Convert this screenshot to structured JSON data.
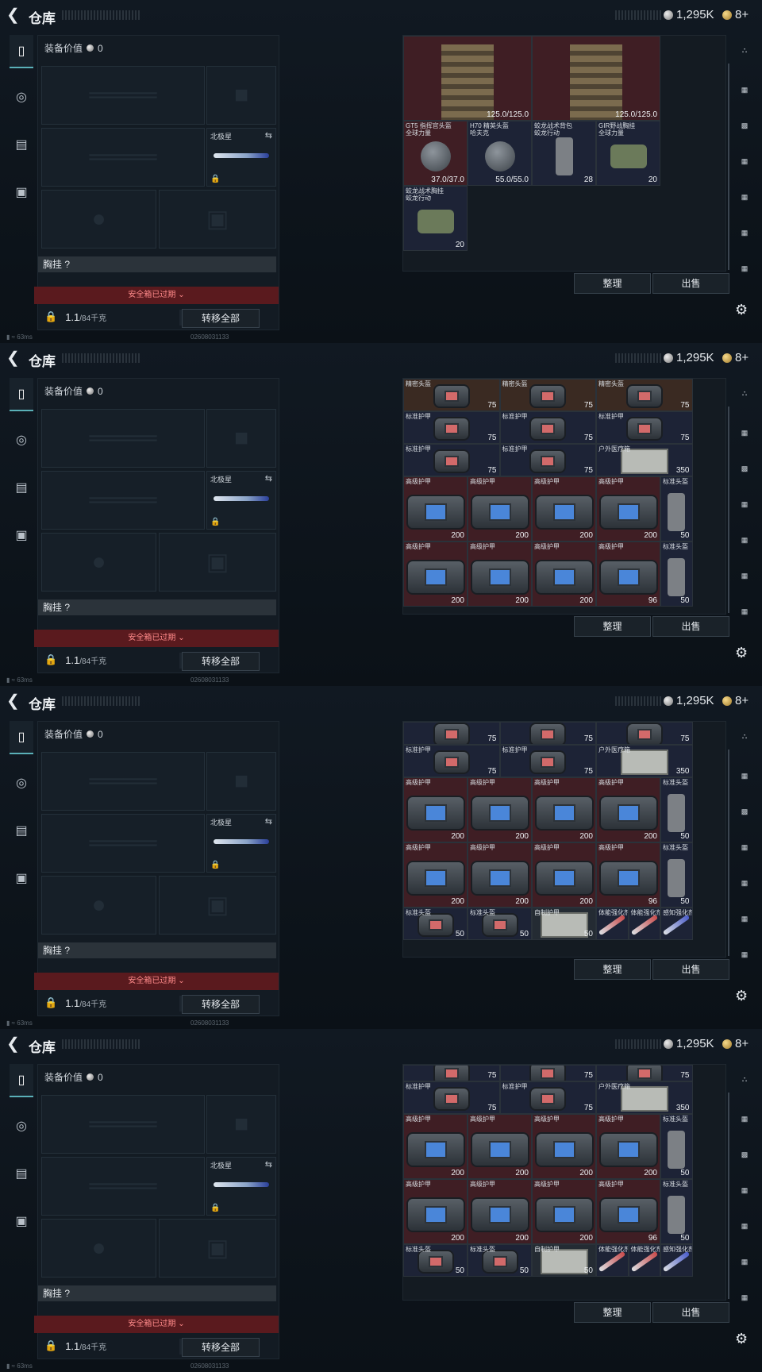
{
  "header": {
    "title": "仓库",
    "silver": "1,295K",
    "gold": "8+"
  },
  "left": {
    "equip_value_label": "装备价值",
    "equip_value": "0",
    "knife_name": "北极星",
    "chest_label": "胸挂",
    "chest_help": "?",
    "safebox": "安全箱已过期",
    "weight": "1.1",
    "weight_cap": "/84千克",
    "transfer_all": "转移全部"
  },
  "footer": {
    "sort": "整理",
    "sell": "出售",
    "ping": "63ms",
    "id": "02608031133"
  },
  "frames": [
    {
      "items": [
        {
          "name": "",
          "value": "125.0/125.0",
          "kind": "armorpiece",
          "bg": "red",
          "c": 0,
          "r": 0,
          "w": 2,
          "h": 1.3
        },
        {
          "name": "",
          "value": "125.0/125.0",
          "kind": "armorpiece",
          "bg": "red",
          "c": 2,
          "r": 0,
          "w": 2,
          "h": 1.3
        },
        {
          "name": "GT5 指挥官头盔\n全球力量",
          "value": "37.0/37.0",
          "kind": "helm",
          "bg": "red",
          "c": 0,
          "r": 1.3,
          "w": 1,
          "h": 1
        },
        {
          "name": "H70 精英头盔\n哈夫克",
          "value": "55.0/55.0",
          "kind": "helm",
          "bg": "blue",
          "c": 1,
          "r": 1.3,
          "w": 1,
          "h": 1
        },
        {
          "name": "蛟龙战术背包\n蛟龙行动",
          "value": "28",
          "kind": "pack",
          "bg": "blue",
          "c": 2,
          "r": 1.3,
          "w": 1,
          "h": 1
        },
        {
          "name": "GIR野战胸挂\n全球力量",
          "value": "20",
          "kind": "rig",
          "bg": "blue",
          "c": 3,
          "r": 1.3,
          "w": 1,
          "h": 1
        },
        {
          "name": "蛟龙战术胸挂\n蛟龙行动",
          "value": "20",
          "kind": "rig",
          "bg": "blue",
          "c": 0,
          "r": 2.3,
          "w": 1,
          "h": 1
        }
      ]
    },
    {
      "items": [
        {
          "name": "精密头盔",
          "value": "75",
          "kind": "vest-s",
          "bg": "brown",
          "c": 0,
          "r": 0,
          "w": 1.5,
          "h": 0.5
        },
        {
          "name": "精密头盔",
          "value": "75",
          "kind": "vest-s",
          "bg": "brown",
          "c": 1.5,
          "r": 0,
          "w": 1.5,
          "h": 0.5
        },
        {
          "name": "精密头盔",
          "value": "75",
          "kind": "vest-s",
          "bg": "brown",
          "c": 3,
          "r": 0,
          "w": 1.5,
          "h": 0.5
        },
        {
          "name": "标准护甲",
          "value": "75",
          "kind": "vest-s",
          "bg": "blue",
          "c": 0,
          "r": 0.5,
          "w": 1.5,
          "h": 0.5
        },
        {
          "name": "标准护甲",
          "value": "75",
          "kind": "vest-s",
          "bg": "blue",
          "c": 1.5,
          "r": 0.5,
          "w": 1.5,
          "h": 0.5
        },
        {
          "name": "标准护甲",
          "value": "75",
          "kind": "vest-s",
          "bg": "blue",
          "c": 3,
          "r": 0.5,
          "w": 1.5,
          "h": 0.5
        },
        {
          "name": "标准护甲",
          "value": "75",
          "kind": "vest-s",
          "bg": "blue",
          "c": 0,
          "r": 1,
          "w": 1.5,
          "h": 0.5
        },
        {
          "name": "标准护甲",
          "value": "75",
          "kind": "vest-s",
          "bg": "blue",
          "c": 1.5,
          "r": 1,
          "w": 1.5,
          "h": 0.5
        },
        {
          "name": "户外医疗箱",
          "value": "350",
          "kind": "med",
          "bg": "blue",
          "c": 3,
          "r": 1,
          "w": 1.5,
          "h": 0.5
        },
        {
          "name": "高级护甲",
          "value": "200",
          "kind": "vest",
          "bg": "red",
          "c": 0,
          "r": 1.5,
          "w": 1,
          "h": 1
        },
        {
          "name": "高级护甲",
          "value": "200",
          "kind": "vest",
          "bg": "red",
          "c": 1,
          "r": 1.5,
          "w": 1,
          "h": 1
        },
        {
          "name": "高级护甲",
          "value": "200",
          "kind": "vest",
          "bg": "red",
          "c": 2,
          "r": 1.5,
          "w": 1,
          "h": 1
        },
        {
          "name": "高级护甲",
          "value": "200",
          "kind": "vest",
          "bg": "red",
          "c": 3,
          "r": 1.5,
          "w": 1,
          "h": 1
        },
        {
          "name": "标准头盔",
          "value": "50",
          "kind": "pack",
          "bg": "blue",
          "c": 4,
          "r": 1.5,
          "w": 0.5,
          "h": 1
        },
        {
          "name": "高级护甲",
          "value": "200",
          "kind": "vest",
          "bg": "red",
          "c": 0,
          "r": 2.5,
          "w": 1,
          "h": 1
        },
        {
          "name": "高级护甲",
          "value": "200",
          "kind": "vest",
          "bg": "red",
          "c": 1,
          "r": 2.5,
          "w": 1,
          "h": 1
        },
        {
          "name": "高级护甲",
          "value": "200",
          "kind": "vest",
          "bg": "red",
          "c": 2,
          "r": 2.5,
          "w": 1,
          "h": 1
        },
        {
          "name": "高级护甲",
          "value": "96",
          "kind": "vest",
          "bg": "red",
          "c": 3,
          "r": 2.5,
          "w": 1,
          "h": 1
        },
        {
          "name": "标准头盔",
          "value": "50",
          "kind": "pack",
          "bg": "blue",
          "c": 4,
          "r": 2.5,
          "w": 0.5,
          "h": 1
        }
      ]
    },
    {
      "items": [
        {
          "name": "",
          "value": "75",
          "kind": "vest-s",
          "bg": "blue",
          "c": 0,
          "r": 0,
          "w": 1.5,
          "h": 0.35
        },
        {
          "name": "",
          "value": "75",
          "kind": "vest-s",
          "bg": "blue",
          "c": 1.5,
          "r": 0,
          "w": 1.5,
          "h": 0.35
        },
        {
          "name": "",
          "value": "75",
          "kind": "vest-s",
          "bg": "blue",
          "c": 3,
          "r": 0,
          "w": 1.5,
          "h": 0.35
        },
        {
          "name": "标准护甲",
          "value": "75",
          "kind": "vest-s",
          "bg": "blue",
          "c": 0,
          "r": 0.35,
          "w": 1.5,
          "h": 0.5
        },
        {
          "name": "标准护甲",
          "value": "75",
          "kind": "vest-s",
          "bg": "blue",
          "c": 1.5,
          "r": 0.35,
          "w": 1.5,
          "h": 0.5
        },
        {
          "name": "户外医疗箱",
          "value": "350",
          "kind": "med",
          "bg": "blue",
          "c": 3,
          "r": 0.35,
          "w": 1.5,
          "h": 0.5
        },
        {
          "name": "高级护甲",
          "value": "200",
          "kind": "vest",
          "bg": "red",
          "c": 0,
          "r": 0.85,
          "w": 1,
          "h": 1
        },
        {
          "name": "高级护甲",
          "value": "200",
          "kind": "vest",
          "bg": "red",
          "c": 1,
          "r": 0.85,
          "w": 1,
          "h": 1
        },
        {
          "name": "高级护甲",
          "value": "200",
          "kind": "vest",
          "bg": "red",
          "c": 2,
          "r": 0.85,
          "w": 1,
          "h": 1
        },
        {
          "name": "高级护甲",
          "value": "200",
          "kind": "vest",
          "bg": "red",
          "c": 3,
          "r": 0.85,
          "w": 1,
          "h": 1
        },
        {
          "name": "标准头盔",
          "value": "50",
          "kind": "pack",
          "bg": "blue",
          "c": 4,
          "r": 0.85,
          "w": 0.5,
          "h": 1
        },
        {
          "name": "高级护甲",
          "value": "200",
          "kind": "vest",
          "bg": "red",
          "c": 0,
          "r": 1.85,
          "w": 1,
          "h": 1
        },
        {
          "name": "高级护甲",
          "value": "200",
          "kind": "vest",
          "bg": "red",
          "c": 1,
          "r": 1.85,
          "w": 1,
          "h": 1
        },
        {
          "name": "高级护甲",
          "value": "200",
          "kind": "vest",
          "bg": "red",
          "c": 2,
          "r": 1.85,
          "w": 1,
          "h": 1
        },
        {
          "name": "高级护甲",
          "value": "96",
          "kind": "vest",
          "bg": "red",
          "c": 3,
          "r": 1.85,
          "w": 1,
          "h": 1
        },
        {
          "name": "标准头盔",
          "value": "50",
          "kind": "pack",
          "bg": "blue",
          "c": 4,
          "r": 1.85,
          "w": 0.5,
          "h": 1
        },
        {
          "name": "标准头盔",
          "value": "50",
          "kind": "vest-s",
          "bg": "blue",
          "c": 0,
          "r": 2.85,
          "w": 1,
          "h": 0.5
        },
        {
          "name": "标准头盔",
          "value": "50",
          "kind": "vest-s",
          "bg": "blue",
          "c": 1,
          "r": 2.85,
          "w": 1,
          "h": 0.5
        },
        {
          "name": "自制护甲",
          "value": "50",
          "kind": "med",
          "bg": "gray",
          "c": 2,
          "r": 2.85,
          "w": 1,
          "h": 0.5
        },
        {
          "name": "体能强化剂",
          "value": "",
          "kind": "inj",
          "bg": "blue",
          "c": 3,
          "r": 2.85,
          "w": 0.5,
          "h": 0.5
        },
        {
          "name": "体能强化剂",
          "value": "",
          "kind": "inj",
          "bg": "blue",
          "c": 3.5,
          "r": 2.85,
          "w": 0.5,
          "h": 0.5
        },
        {
          "name": "感知强化剂",
          "value": "",
          "kind": "inj-b",
          "bg": "blue",
          "c": 4,
          "r": 2.85,
          "w": 0.5,
          "h": 0.5
        }
      ]
    },
    {
      "items": [
        {
          "name": "",
          "value": "75",
          "kind": "vest-s",
          "bg": "blue",
          "c": 0,
          "r": 0,
          "w": 1.5,
          "h": 0.25
        },
        {
          "name": "",
          "value": "75",
          "kind": "vest-s",
          "bg": "blue",
          "c": 1.5,
          "r": 0,
          "w": 1.5,
          "h": 0.25
        },
        {
          "name": "",
          "value": "75",
          "kind": "vest-s",
          "bg": "blue",
          "c": 3,
          "r": 0,
          "w": 1.5,
          "h": 0.25
        },
        {
          "name": "标准护甲",
          "value": "75",
          "kind": "vest-s",
          "bg": "blue",
          "c": 0,
          "r": 0.25,
          "w": 1.5,
          "h": 0.5
        },
        {
          "name": "标准护甲",
          "value": "75",
          "kind": "vest-s",
          "bg": "blue",
          "c": 1.5,
          "r": 0.25,
          "w": 1.5,
          "h": 0.5
        },
        {
          "name": "户外医疗箱",
          "value": "350",
          "kind": "med",
          "bg": "blue",
          "c": 3,
          "r": 0.25,
          "w": 1.5,
          "h": 0.5
        },
        {
          "name": "高级护甲",
          "value": "200",
          "kind": "vest",
          "bg": "red",
          "c": 0,
          "r": 0.75,
          "w": 1,
          "h": 1
        },
        {
          "name": "高级护甲",
          "value": "200",
          "kind": "vest",
          "bg": "red",
          "c": 1,
          "r": 0.75,
          "w": 1,
          "h": 1
        },
        {
          "name": "高级护甲",
          "value": "200",
          "kind": "vest",
          "bg": "red",
          "c": 2,
          "r": 0.75,
          "w": 1,
          "h": 1
        },
        {
          "name": "高级护甲",
          "value": "200",
          "kind": "vest",
          "bg": "red",
          "c": 3,
          "r": 0.75,
          "w": 1,
          "h": 1
        },
        {
          "name": "标准头盔",
          "value": "50",
          "kind": "pack",
          "bg": "blue",
          "c": 4,
          "r": 0.75,
          "w": 0.5,
          "h": 1
        },
        {
          "name": "高级护甲",
          "value": "200",
          "kind": "vest",
          "bg": "red",
          "c": 0,
          "r": 1.75,
          "w": 1,
          "h": 1
        },
        {
          "name": "高级护甲",
          "value": "200",
          "kind": "vest",
          "bg": "red",
          "c": 1,
          "r": 1.75,
          "w": 1,
          "h": 1
        },
        {
          "name": "高级护甲",
          "value": "200",
          "kind": "vest",
          "bg": "red",
          "c": 2,
          "r": 1.75,
          "w": 1,
          "h": 1
        },
        {
          "name": "高级护甲",
          "value": "96",
          "kind": "vest",
          "bg": "red",
          "c": 3,
          "r": 1.75,
          "w": 1,
          "h": 1
        },
        {
          "name": "标准头盔",
          "value": "50",
          "kind": "pack",
          "bg": "blue",
          "c": 4,
          "r": 1.75,
          "w": 0.5,
          "h": 1
        },
        {
          "name": "标准头盔",
          "value": "50",
          "kind": "vest-s",
          "bg": "blue",
          "c": 0,
          "r": 2.75,
          "w": 1,
          "h": 0.5
        },
        {
          "name": "标准头盔",
          "value": "50",
          "kind": "vest-s",
          "bg": "blue",
          "c": 1,
          "r": 2.75,
          "w": 1,
          "h": 0.5
        },
        {
          "name": "自制护甲",
          "value": "50",
          "kind": "med",
          "bg": "gray",
          "c": 2,
          "r": 2.75,
          "w": 1,
          "h": 0.5
        },
        {
          "name": "体能强化剂",
          "value": "",
          "kind": "inj",
          "bg": "blue",
          "c": 3,
          "r": 2.75,
          "w": 0.5,
          "h": 0.5
        },
        {
          "name": "体能强化剂",
          "value": "",
          "kind": "inj",
          "bg": "blue",
          "c": 3.5,
          "r": 2.75,
          "w": 0.5,
          "h": 0.5
        },
        {
          "name": "感知强化剂",
          "value": "",
          "kind": "inj-b",
          "bg": "blue",
          "c": 4,
          "r": 2.75,
          "w": 0.5,
          "h": 0.5
        }
      ]
    }
  ]
}
